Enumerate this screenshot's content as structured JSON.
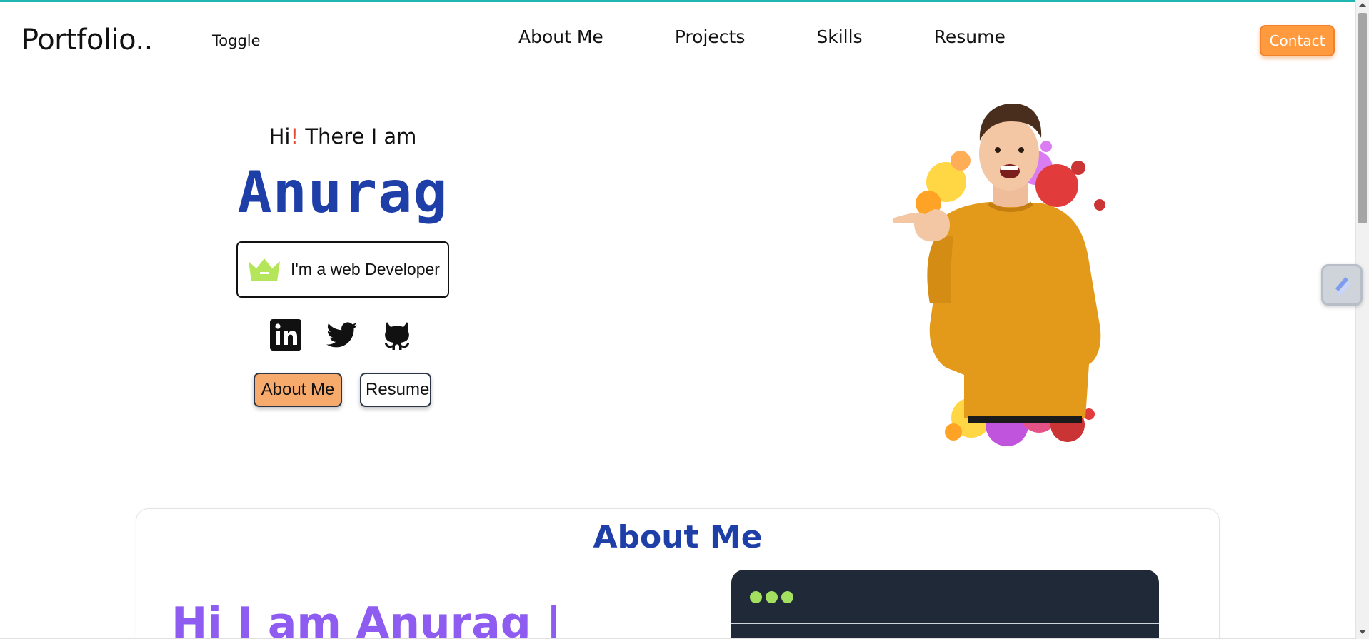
{
  "navbar": {
    "brand": "Portfolio..",
    "toggle": "Toggle",
    "links": [
      "About Me",
      "Projects",
      "Skills",
      "Resume"
    ],
    "contact": "Contact"
  },
  "hero": {
    "greeting_pre": "Hi",
    "greeting_bang": "!",
    "greeting_post": " There I am",
    "name": "Anurag",
    "role": "I'm a web Developer",
    "buttons": {
      "about": "About Me",
      "resume": "Resume"
    },
    "social_icons": [
      "linkedin-icon",
      "twitter-icon",
      "github-icon"
    ]
  },
  "about": {
    "title": "About Me",
    "greeting": "Hi I am Anurag |"
  },
  "colors": {
    "accent_teal": "#1fb5b0",
    "contact_orange": "#ff9a3e",
    "name_blue": "#1f3fa8",
    "about_purple": "#8e5cf0",
    "code_bg": "#1f2937",
    "dot_green": "#a3e060"
  }
}
